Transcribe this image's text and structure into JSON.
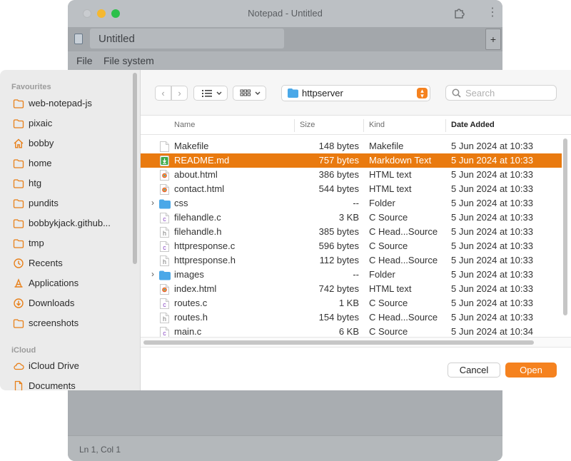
{
  "window": {
    "title": "Notepad - Untitled",
    "tab_label": "Untitled",
    "plus_label": "+",
    "menu": [
      "File",
      "File system"
    ],
    "status": "Ln 1, Col 1"
  },
  "sidebar": {
    "favourites_heading": "Favourites",
    "favourites": [
      {
        "label": "web-notepad-js",
        "icon": "folder-icon"
      },
      {
        "label": "pixaic",
        "icon": "folder-icon"
      },
      {
        "label": "bobby",
        "icon": "home-icon"
      },
      {
        "label": "home",
        "icon": "folder-icon"
      },
      {
        "label": "htg",
        "icon": "folder-icon"
      },
      {
        "label": "pundits",
        "icon": "folder-icon"
      },
      {
        "label": "bobbykjack.github...",
        "icon": "folder-icon"
      },
      {
        "label": "tmp",
        "icon": "folder-icon"
      },
      {
        "label": "Recents",
        "icon": "clock-icon"
      },
      {
        "label": "Applications",
        "icon": "applications-icon"
      },
      {
        "label": "Downloads",
        "icon": "download-icon"
      },
      {
        "label": "screenshots",
        "icon": "folder-icon"
      }
    ],
    "icloud_heading": "iCloud",
    "icloud": [
      {
        "label": "iCloud Drive",
        "icon": "cloud-icon"
      },
      {
        "label": "Documents",
        "icon": "document-icon"
      }
    ]
  },
  "toolbar": {
    "back": "‹",
    "forward": "›",
    "location": "httpserver",
    "search_placeholder": "Search"
  },
  "columns": {
    "name": "Name",
    "size": "Size",
    "kind": "Kind",
    "date": "Date Added"
  },
  "files": [
    {
      "name": "Makefile",
      "size": "148 bytes",
      "kind": "Makefile",
      "date": "5 Jun 2024 at 10:33",
      "icon": "blank",
      "folder": false,
      "selected": false
    },
    {
      "name": "README.md",
      "size": "757 bytes",
      "kind": "Markdown Text",
      "date": "5 Jun 2024 at 10:33",
      "icon": "markdown",
      "folder": false,
      "selected": true
    },
    {
      "name": "about.html",
      "size": "386 bytes",
      "kind": "HTML text",
      "date": "5 Jun 2024 at 10:33",
      "icon": "html",
      "folder": false,
      "selected": false
    },
    {
      "name": "contact.html",
      "size": "544 bytes",
      "kind": "HTML text",
      "date": "5 Jun 2024 at 10:33",
      "icon": "html",
      "folder": false,
      "selected": false
    },
    {
      "name": "css",
      "size": "--",
      "kind": "Folder",
      "date": "5 Jun 2024 at 10:33",
      "icon": "folder",
      "folder": true,
      "selected": false
    },
    {
      "name": "filehandle.c",
      "size": "3 KB",
      "kind": "C Source",
      "date": "5 Jun 2024 at 10:33",
      "icon": "c",
      "folder": false,
      "selected": false
    },
    {
      "name": "filehandle.h",
      "size": "385 bytes",
      "kind": "C Head...Source",
      "date": "5 Jun 2024 at 10:33",
      "icon": "h",
      "folder": false,
      "selected": false
    },
    {
      "name": "httpresponse.c",
      "size": "596 bytes",
      "kind": "C Source",
      "date": "5 Jun 2024 at 10:33",
      "icon": "c",
      "folder": false,
      "selected": false
    },
    {
      "name": "httpresponse.h",
      "size": "112 bytes",
      "kind": "C Head...Source",
      "date": "5 Jun 2024 at 10:33",
      "icon": "h",
      "folder": false,
      "selected": false
    },
    {
      "name": "images",
      "size": "--",
      "kind": "Folder",
      "date": "5 Jun 2024 at 10:33",
      "icon": "folder",
      "folder": true,
      "selected": false
    },
    {
      "name": "index.html",
      "size": "742 bytes",
      "kind": "HTML text",
      "date": "5 Jun 2024 at 10:33",
      "icon": "html",
      "folder": false,
      "selected": false
    },
    {
      "name": "routes.c",
      "size": "1 KB",
      "kind": "C Source",
      "date": "5 Jun 2024 at 10:33",
      "icon": "c",
      "folder": false,
      "selected": false
    },
    {
      "name": "routes.h",
      "size": "154 bytes",
      "kind": "C Head...Source",
      "date": "5 Jun 2024 at 10:33",
      "icon": "h",
      "folder": false,
      "selected": false
    },
    {
      "name": "main.c",
      "size": "6 KB",
      "kind": "C Source",
      "date": "5 Jun 2024 at 10:34",
      "icon": "c",
      "folder": false,
      "selected": false
    }
  ],
  "buttons": {
    "cancel": "Cancel",
    "open": "Open"
  },
  "colors": {
    "accent": "#f5821f",
    "selection": "#e97a0f",
    "folder": "#4aa8e8"
  }
}
